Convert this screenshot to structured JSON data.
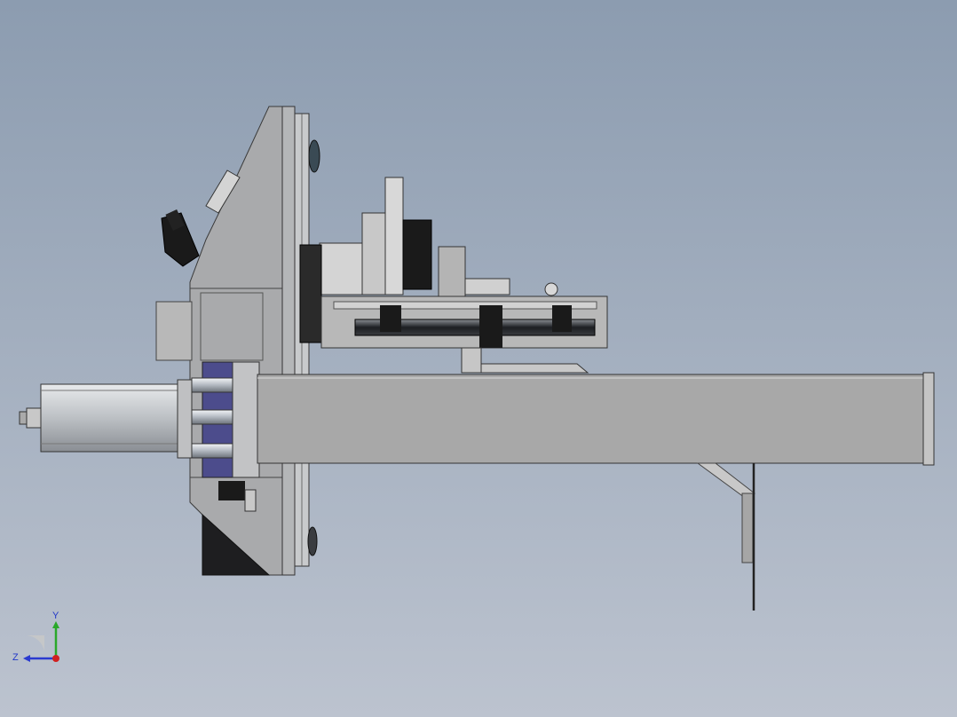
{
  "viewport": {
    "background_top": "#8c9cb0",
    "background_bottom": "#bcc3cf"
  },
  "triad": {
    "y_label": "Y",
    "z_label": "Z",
    "y_axis_color": "#2aa82a",
    "z_axis_color": "#2a3ad0",
    "x_axis_color": "#d02020"
  }
}
